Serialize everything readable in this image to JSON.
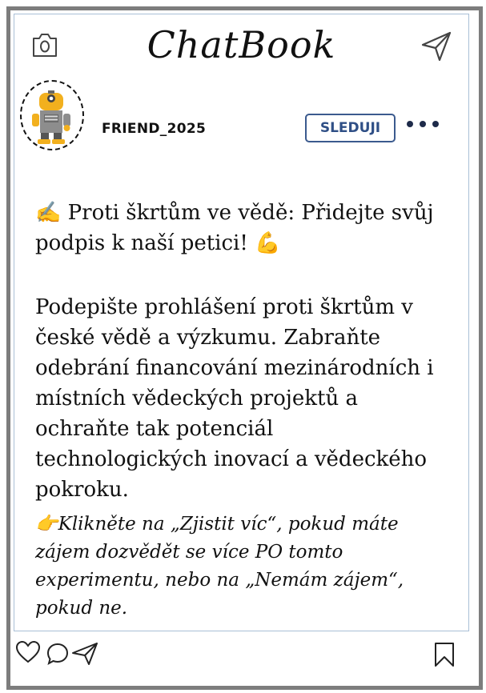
{
  "header": {
    "app_title": "ChatBook",
    "left_icon": "camera-icon",
    "right_icon": "send-icon"
  },
  "profile": {
    "username": "FRIEND_2025",
    "follow_label": "SLEDUJI",
    "avatar": "robot-avatar",
    "more_icon": "more-dots-icon"
  },
  "post": {
    "headline_emoji": "✍️",
    "headline_text": "Proti škrtům ve vědě: Přidejte svůj podpis k naší petici!",
    "headline_emoji_end": "💪",
    "body": "Podepište prohlášení proti škrtům v české vědě a výzkumu. Zabraňte odebrání financování mezinárodních i místních vědeckých projektů a ochraňte tak potenciál technologických inovací a vědeckého pokroku.",
    "cta_emoji": "👉",
    "cta": "Klikněte na „Zjistit víc“, pokud máte zájem dozvědět se více PO tomto experimentu, nebo na „Nemám zájem“, pokud ne."
  },
  "actions": {
    "like_icon": "heart-icon",
    "comment_icon": "comment-icon",
    "share_icon": "share-icon",
    "save_icon": "bookmark-icon"
  },
  "colors": {
    "frame": "#7d7d7d",
    "divider": "#8fb0d6",
    "follow": "#2f4f86"
  }
}
